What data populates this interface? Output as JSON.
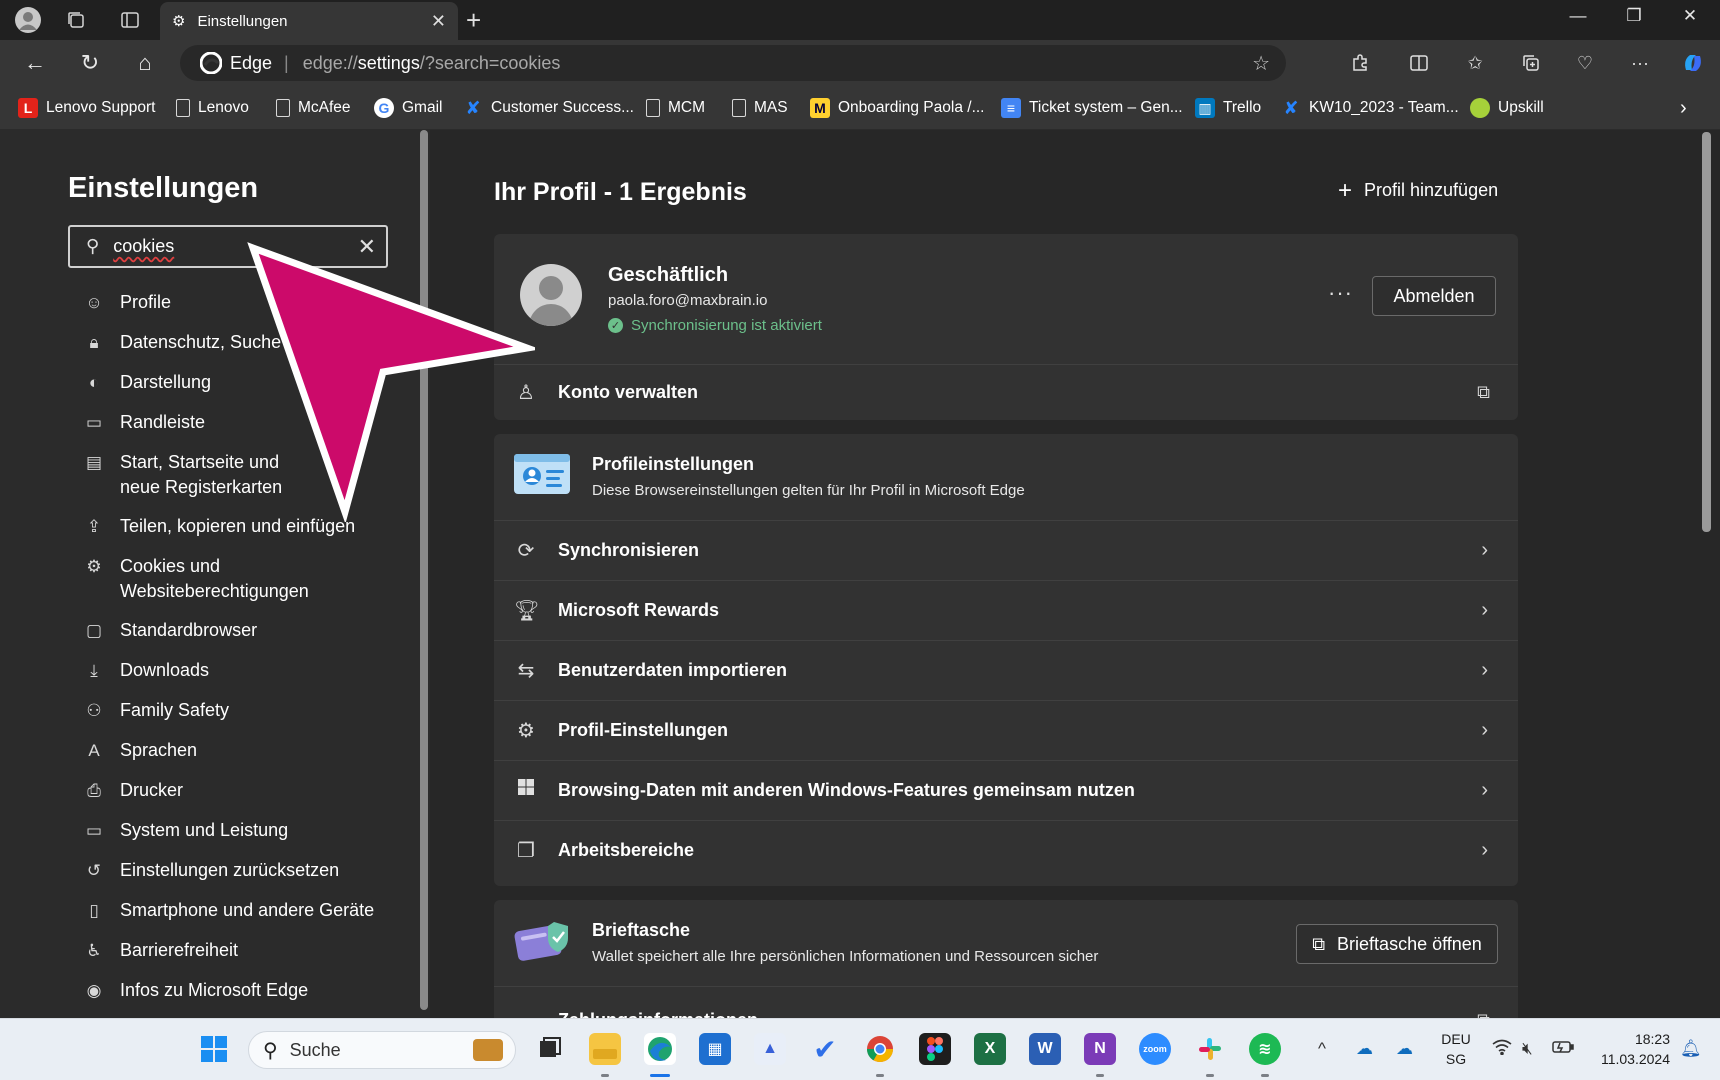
{
  "colors": {
    "accent": "#0078d4",
    "arrow": "#cc0a6a",
    "sync_ok": "#6cc08b"
  },
  "browser": {
    "tab": {
      "title": "Einstellungen",
      "icon": "gear-icon"
    },
    "address": {
      "identity": "Edge",
      "url_prefix": "edge://",
      "url_host": "settings",
      "url_rest": "/?search=cookies"
    }
  },
  "favorites": [
    {
      "label": "Lenovo Support",
      "icon": "lenovo-l-icon"
    },
    {
      "label": "Lenovo",
      "icon": "page-icon"
    },
    {
      "label": "McAfee",
      "icon": "page-icon"
    },
    {
      "label": "Gmail",
      "icon": "google-icon"
    },
    {
      "label": "Customer Success...",
      "icon": "jira-icon"
    },
    {
      "label": "MCM",
      "icon": "page-icon"
    },
    {
      "label": "MAS",
      "icon": "page-icon"
    },
    {
      "label": "Onboarding Paola /...",
      "icon": "miro-icon"
    },
    {
      "label": "Ticket system – Gen...",
      "icon": "docs-icon"
    },
    {
      "label": "Trello",
      "icon": "trello-icon"
    },
    {
      "label": "KW10_2023 - Team...",
      "icon": "jira-icon"
    },
    {
      "label": "Upskill",
      "icon": "upskill-icon"
    }
  ],
  "sidebar": {
    "title": "Einstellungen",
    "search_value": "cookies",
    "items": [
      {
        "label": "Profile",
        "icon": "profile-icon"
      },
      {
        "label": "Datenschutz, Suche und Dienste",
        "icon": "lock-icon"
      },
      {
        "label": "Darstellung",
        "icon": "palette-icon"
      },
      {
        "label": "Randleiste",
        "icon": "sidebar-icon"
      },
      {
        "label": "Start, Startseite und neue Registerkarten",
        "icon": "start-icon"
      },
      {
        "label": "Teilen, kopieren und einfügen",
        "icon": "share-icon"
      },
      {
        "label": "Cookies und Websiteberechtigungen",
        "icon": "cookies-icon"
      },
      {
        "label": "Standardbrowser",
        "icon": "default-browser-icon"
      },
      {
        "label": "Downloads",
        "icon": "download-icon"
      },
      {
        "label": "Family Safety",
        "icon": "family-icon"
      },
      {
        "label": "Sprachen",
        "icon": "language-icon"
      },
      {
        "label": "Drucker",
        "icon": "printer-icon"
      },
      {
        "label": "System und Leistung",
        "icon": "laptop-icon"
      },
      {
        "label": "Einstellungen zurücksetzen",
        "icon": "reset-icon"
      },
      {
        "label": "Smartphone und andere Geräte",
        "icon": "phone-icon"
      },
      {
        "label": "Barrierefreiheit",
        "icon": "accessibility-icon"
      },
      {
        "label": "Infos zu Microsoft Edge",
        "icon": "edge-icon"
      }
    ]
  },
  "main": {
    "result_title": "Ihr Profil - 1 Ergebnis",
    "add_profile": "Profil hinzufügen",
    "profile": {
      "name": "Geschäftlich",
      "email": "paola.foro@maxbrain.io",
      "sync_status": "Synchronisierung ist aktiviert",
      "more": "···",
      "signout": "Abmelden",
      "manage": "Konto verwalten"
    },
    "profile_settings": {
      "title": "Profileinstellungen",
      "desc": "Diese Browsereinstellungen gelten für Ihr Profil in Microsoft Edge",
      "rows": [
        {
          "label": "Synchronisieren",
          "icon": "sync-icon"
        },
        {
          "label": "Microsoft Rewards",
          "icon": "trophy-icon"
        },
        {
          "label": "Benutzerdaten importieren",
          "icon": "import-icon"
        },
        {
          "label": "Profil-Einstellungen",
          "icon": "profile-settings-icon"
        },
        {
          "label": "Browsing-Daten mit anderen Windows-Features gemeinsam nutzen",
          "icon": "windows-icon"
        },
        {
          "label": "Arbeitsbereiche",
          "icon": "workspaces-icon"
        }
      ]
    },
    "wallet": {
      "title": "Brieftasche",
      "desc": "Wallet speichert alle Ihre persönlichen Informationen und Ressourcen sicher",
      "button": "Brieftasche öffnen",
      "next_row": "Zahlungsinformationen"
    }
  },
  "taskbar": {
    "search_placeholder": "Suche",
    "lang_top": "DEU",
    "lang_bottom": "SG",
    "time": "18:23",
    "date": "11.03.2024"
  }
}
